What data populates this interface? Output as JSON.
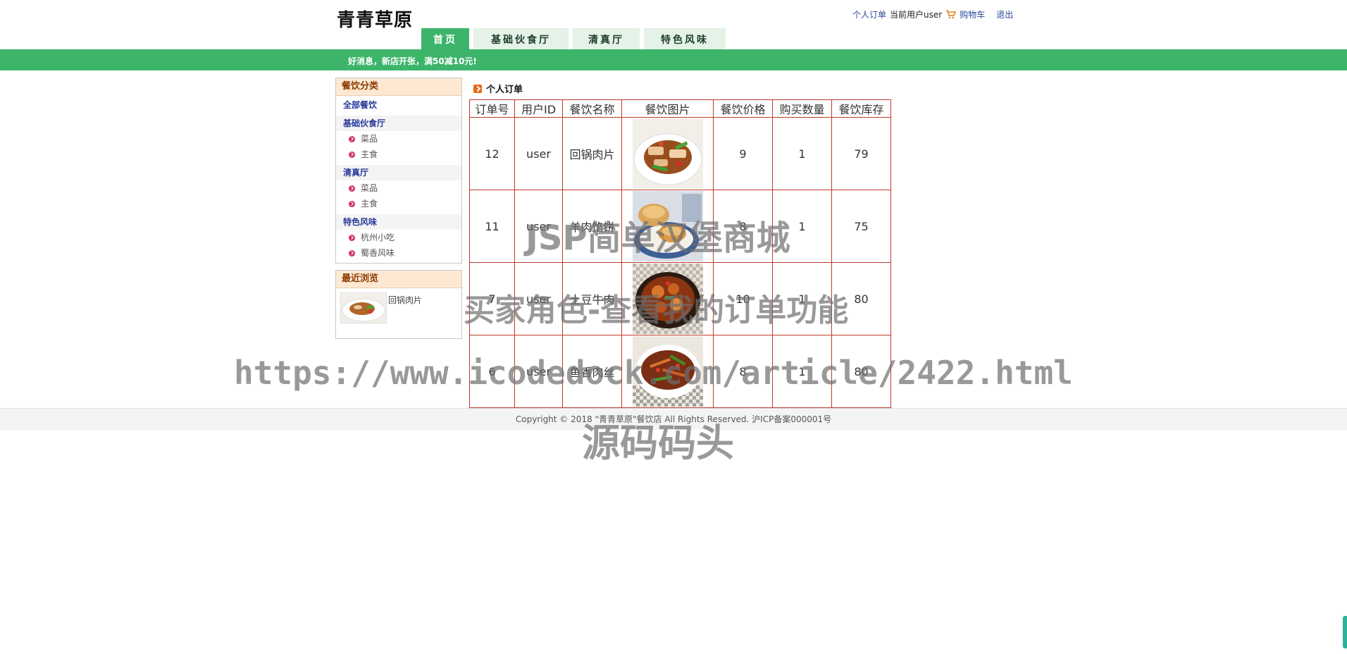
{
  "header": {
    "logo": "青青草原",
    "links": {
      "orders": "个人订单",
      "current_user": "当前用户user",
      "cart": "购物车",
      "logout": "退出"
    }
  },
  "nav": {
    "tabs": [
      "首页",
      "基础伙食厅",
      "清真厅",
      "特色风味"
    ],
    "active": 0
  },
  "banner": "好消息，新店开张，满50减10元!",
  "sidebar": {
    "category_title": "餐饮分类",
    "all": "全部餐饮",
    "groups": [
      {
        "name": "基础伙食厅",
        "items": [
          "菜品",
          "主食"
        ]
      },
      {
        "name": "清真厅",
        "items": [
          "菜品",
          "主食"
        ]
      },
      {
        "name": "特色风味",
        "items": [
          "杭州小吃",
          "蜀香风味"
        ]
      }
    ],
    "recent_title": "最近浏览",
    "recent_item": "回锅肉片"
  },
  "section_title": "个人订单",
  "table": {
    "headers": [
      "订单号",
      "用户ID",
      "餐饮名称",
      "餐饮图片",
      "餐饮价格",
      "购买数量",
      "餐饮库存"
    ],
    "rows": [
      {
        "id": "12",
        "user": "user",
        "name": "回锅肉片",
        "price": "9",
        "qty": "1",
        "stock": "79"
      },
      {
        "id": "11",
        "user": "user",
        "name": "羊肉馅饼",
        "price": "8",
        "qty": "1",
        "stock": "75"
      },
      {
        "id": "7",
        "user": "user",
        "name": "土豆牛肉",
        "price": "10",
        "qty": "1",
        "stock": "80"
      },
      {
        "id": "6",
        "user": "user",
        "name": "鱼香肉丝",
        "price": "8",
        "qty": "1",
        "stock": "80"
      }
    ]
  },
  "footer": "Copyright © 2018 \"青青草原\"餐饮店 All Rights Reserved. 沪ICP备案000001号",
  "watermarks": {
    "line1": "JSP简单汉堡商城",
    "line2": "买家角色-查看我的订单功能",
    "line3": "https://www.icodedock.com/article/2422.html",
    "line4": "源码码头"
  },
  "colors": {
    "accent_green": "#3cb56b",
    "table_border": "#c0392b",
    "link_blue": "#2d4a9a"
  }
}
